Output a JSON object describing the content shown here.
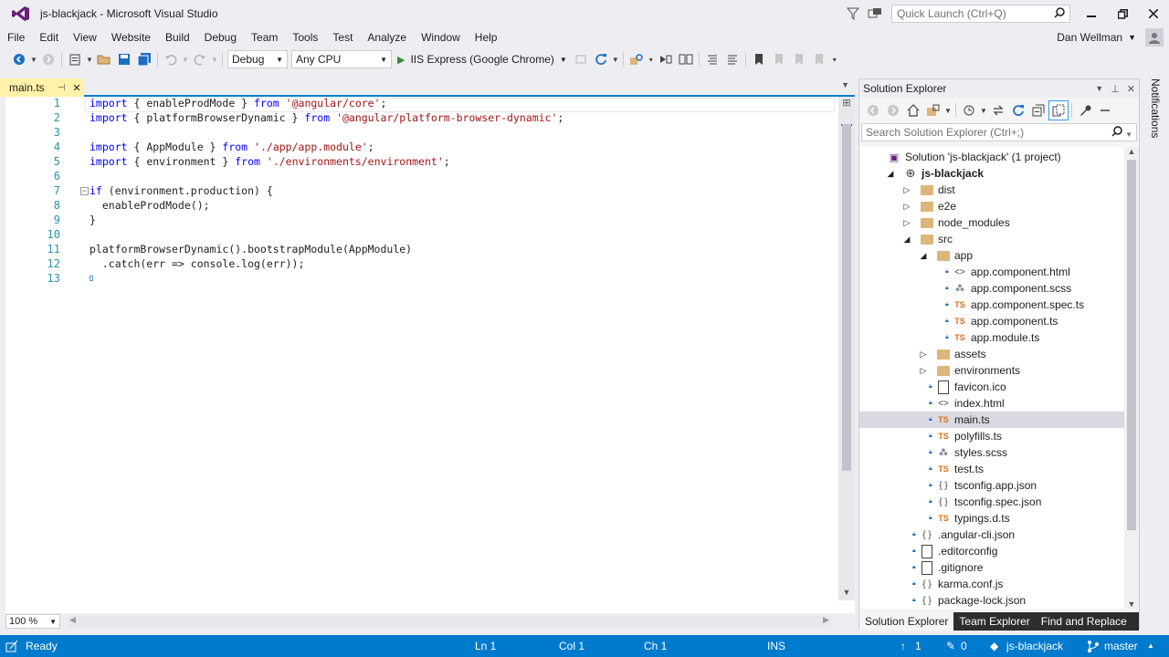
{
  "window": {
    "title": "js-blackjack - Microsoft Visual Studio",
    "quick_launch_placeholder": "Quick Launch (Ctrl+Q)"
  },
  "menu": [
    "File",
    "Edit",
    "View",
    "Website",
    "Build",
    "Debug",
    "Team",
    "Tools",
    "Test",
    "Analyze",
    "Window",
    "Help"
  ],
  "user": {
    "name": "Dan Wellman"
  },
  "toolbar": {
    "config": "Debug",
    "platform": "Any CPU",
    "run_target": "IIS Express (Google Chrome)"
  },
  "editor": {
    "tab": {
      "label": "main.ts"
    },
    "zoom": "100 %",
    "lines": [
      [
        {
          "k": "kw",
          "t": "import"
        },
        {
          "k": "",
          "t": " { enableProdMode } "
        },
        {
          "k": "kw",
          "t": "from"
        },
        {
          "k": "",
          "t": " "
        },
        {
          "k": "str",
          "t": "'@angular/core'"
        },
        {
          "k": "",
          "t": ";"
        }
      ],
      [
        {
          "k": "kw",
          "t": "import"
        },
        {
          "k": "",
          "t": " { platformBrowserDynamic } "
        },
        {
          "k": "kw",
          "t": "from"
        },
        {
          "k": "",
          "t": " "
        },
        {
          "k": "str",
          "t": "'@angular/platform-browser-dynamic'"
        },
        {
          "k": "",
          "t": ";"
        }
      ],
      [],
      [
        {
          "k": "kw",
          "t": "import"
        },
        {
          "k": "",
          "t": " { AppModule } "
        },
        {
          "k": "kw",
          "t": "from"
        },
        {
          "k": "",
          "t": " "
        },
        {
          "k": "str",
          "t": "'./app/app.module'"
        },
        {
          "k": "",
          "t": ";"
        }
      ],
      [
        {
          "k": "kw",
          "t": "import"
        },
        {
          "k": "",
          "t": " { environment } "
        },
        {
          "k": "kw",
          "t": "from"
        },
        {
          "k": "",
          "t": " "
        },
        {
          "k": "str",
          "t": "'./environments/environment'"
        },
        {
          "k": "",
          "t": ";"
        }
      ],
      [],
      [
        {
          "k": "kw",
          "t": "if"
        },
        {
          "k": "",
          "t": " (environment.production) {"
        }
      ],
      [
        {
          "k": "",
          "t": "  enableProdMode();"
        }
      ],
      [
        {
          "k": "",
          "t": "}"
        }
      ],
      [],
      [
        {
          "k": "",
          "t": "platformBrowserDynamic().bootstrapModule(AppModule)"
        }
      ],
      [
        {
          "k": "",
          "t": "  .catch(err => console.log(err));"
        }
      ],
      []
    ],
    "line_numbers": [
      "1",
      "2",
      "3",
      "4",
      "5",
      "6",
      "7",
      "8",
      "9",
      "10",
      "11",
      "12",
      "13"
    ]
  },
  "solution_explorer": {
    "title": "Solution Explorer",
    "search_placeholder": "Search Solution Explorer (Ctrl+;)",
    "tree": [
      {
        "depth": 0,
        "arrow": "",
        "icon": "sln",
        "label": "Solution 'js-blackjack' (1 project)",
        "bold": false,
        "lock": false
      },
      {
        "depth": 1,
        "arrow": "open",
        "icon": "globe",
        "label": "js-blackjack",
        "bold": true,
        "lock": false
      },
      {
        "depth": 2,
        "arrow": "closed",
        "icon": "folder",
        "label": "dist",
        "bold": false,
        "lock": false
      },
      {
        "depth": 2,
        "arrow": "closed",
        "icon": "folder",
        "label": "e2e",
        "bold": false,
        "lock": false
      },
      {
        "depth": 2,
        "arrow": "closed",
        "icon": "folder",
        "label": "node_modules",
        "bold": false,
        "lock": false
      },
      {
        "depth": 2,
        "arrow": "open",
        "icon": "folder",
        "label": "src",
        "bold": false,
        "lock": false
      },
      {
        "depth": 3,
        "arrow": "open",
        "icon": "folder",
        "label": "app",
        "bold": false,
        "lock": false
      },
      {
        "depth": 4,
        "arrow": "",
        "icon": "html",
        "label": "app.component.html",
        "bold": false,
        "lock": true
      },
      {
        "depth": 4,
        "arrow": "",
        "icon": "css",
        "label": "app.component.scss",
        "bold": false,
        "lock": true
      },
      {
        "depth": 4,
        "arrow": "",
        "icon": "ts",
        "label": "app.component.spec.ts",
        "bold": false,
        "lock": true
      },
      {
        "depth": 4,
        "arrow": "",
        "icon": "ts",
        "label": "app.component.ts",
        "bold": false,
        "lock": true
      },
      {
        "depth": 4,
        "arrow": "",
        "icon": "ts",
        "label": "app.module.ts",
        "bold": false,
        "lock": true
      },
      {
        "depth": 3,
        "arrow": "closed",
        "icon": "folder",
        "label": "assets",
        "bold": false,
        "lock": false
      },
      {
        "depth": 3,
        "arrow": "closed",
        "icon": "folder",
        "label": "environments",
        "bold": false,
        "lock": false
      },
      {
        "depth": 3,
        "arrow": "",
        "icon": "file",
        "label": "favicon.ico",
        "bold": false,
        "lock": true
      },
      {
        "depth": 3,
        "arrow": "",
        "icon": "html",
        "label": "index.html",
        "bold": false,
        "lock": true
      },
      {
        "depth": 3,
        "arrow": "",
        "icon": "ts",
        "label": "main.ts",
        "bold": false,
        "lock": true,
        "selected": true
      },
      {
        "depth": 3,
        "arrow": "",
        "icon": "ts",
        "label": "polyfills.ts",
        "bold": false,
        "lock": true
      },
      {
        "depth": 3,
        "arrow": "",
        "icon": "css",
        "label": "styles.scss",
        "bold": false,
        "lock": true
      },
      {
        "depth": 3,
        "arrow": "",
        "icon": "ts",
        "label": "test.ts",
        "bold": false,
        "lock": true
      },
      {
        "depth": 3,
        "arrow": "",
        "icon": "json",
        "label": "tsconfig.app.json",
        "bold": false,
        "lock": true
      },
      {
        "depth": 3,
        "arrow": "",
        "icon": "json",
        "label": "tsconfig.spec.json",
        "bold": false,
        "lock": true
      },
      {
        "depth": 3,
        "arrow": "",
        "icon": "ts",
        "label": "typings.d.ts",
        "bold": false,
        "lock": true
      },
      {
        "depth": 2,
        "arrow": "",
        "icon": "json",
        "label": ".angular-cli.json",
        "bold": false,
        "lock": true
      },
      {
        "depth": 2,
        "arrow": "",
        "icon": "file",
        "label": ".editorconfig",
        "bold": false,
        "lock": true
      },
      {
        "depth": 2,
        "arrow": "",
        "icon": "file",
        "label": ".gitignore",
        "bold": false,
        "lock": true
      },
      {
        "depth": 2,
        "arrow": "",
        "icon": "json",
        "label": "karma.conf.js",
        "bold": false,
        "lock": true
      },
      {
        "depth": 2,
        "arrow": "",
        "icon": "json",
        "label": "package-lock.json",
        "bold": false,
        "lock": true
      }
    ],
    "tabs": [
      "Solution Explorer",
      "Team Explorer",
      "Find and Replace"
    ]
  },
  "notifications_label": "Notifications",
  "statusbar": {
    "state": "Ready",
    "ln": "Ln 1",
    "col": "Col 1",
    "ch": "Ch 1",
    "mode": "INS",
    "up_count": "1",
    "edit_count": "0",
    "repo": "js-blackjack",
    "branch": "master"
  },
  "colors": {
    "accent": "#007acc",
    "tab_active": "#fff1a8",
    "keyword": "#0000ff",
    "string": "#a31515",
    "line_number": "#2b91af"
  },
  "icons": [
    "vs-logo-icon",
    "filter-icon",
    "feedback-icon",
    "search-icon",
    "back-icon",
    "forward-icon",
    "new-project-icon",
    "open-icon",
    "save-icon",
    "save-all-icon",
    "undo-icon",
    "redo-icon",
    "play-icon",
    "refresh-icon",
    "home-icon",
    "sync-icon",
    "wrench-icon",
    "git-branch-icon",
    "pencil-icon",
    "arrow-up-icon"
  ]
}
